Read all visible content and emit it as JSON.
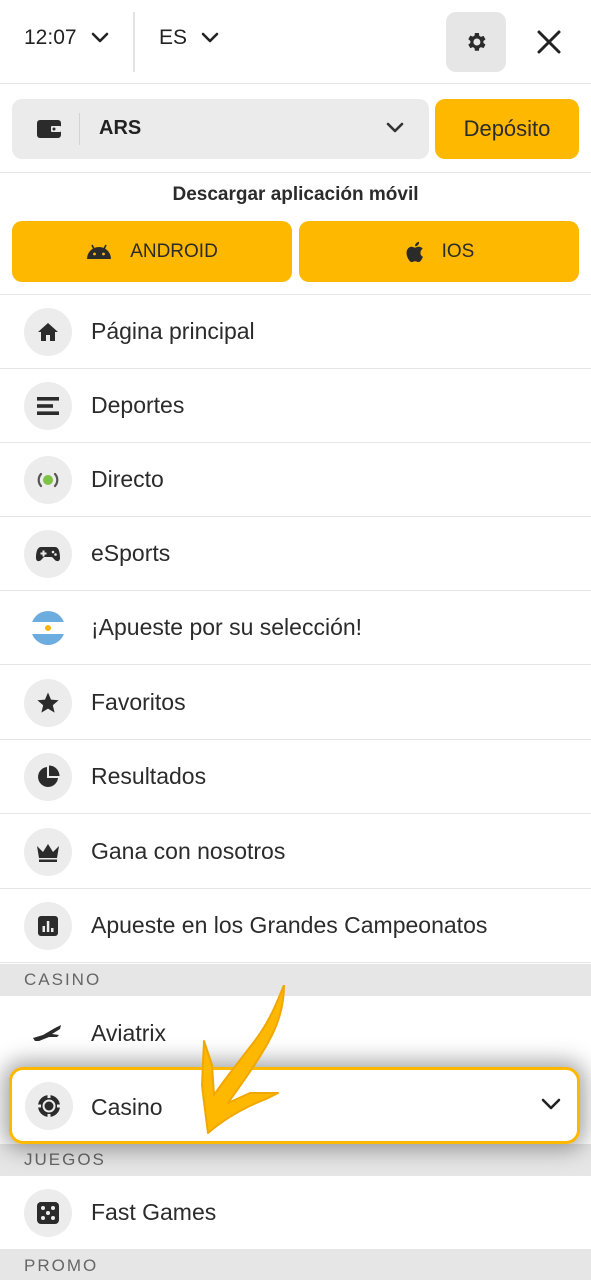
{
  "topbar": {
    "time": "12:07",
    "language": "ES"
  },
  "wallet": {
    "currency": "ARS",
    "deposit_label": "Depósito"
  },
  "download": {
    "title": "Descargar aplicación móvil",
    "android_label": "ANDROID",
    "ios_label": "IOS"
  },
  "menu": {
    "home": "Página principal",
    "sports": "Deportes",
    "live": "Directo",
    "esports": "eSports",
    "team_bet": "¡Apueste por su selección!",
    "favorites": "Favoritos",
    "results": "Resultados",
    "affiliate": "Gana con nosotros",
    "championships": "Apueste en los Grandes Campeonatos"
  },
  "sections": {
    "casino": "CASINO",
    "games": "JUEGOS",
    "promo": "PROMO"
  },
  "casino_items": {
    "aviatrix": "Aviatrix",
    "casino": "Casino"
  },
  "games_items": {
    "fast_games": "Fast Games"
  },
  "colors": {
    "accent": "#ffb800",
    "live_green": "#7dc242",
    "icon_bg": "#ececec",
    "section_bg": "#e6e6e6"
  },
  "icons": [
    "chevron-down-icon",
    "gear-icon",
    "close-icon",
    "wallet-icon",
    "android-icon",
    "apple-icon",
    "home-icon",
    "sports-list-icon",
    "live-icon",
    "gamepad-icon",
    "argentina-flag-icon",
    "star-icon",
    "pie-chart-icon",
    "crown-icon",
    "bar-chart-icon",
    "plane-icon",
    "casino-chip-icon",
    "dice-icon",
    "arrow-annotation"
  ]
}
